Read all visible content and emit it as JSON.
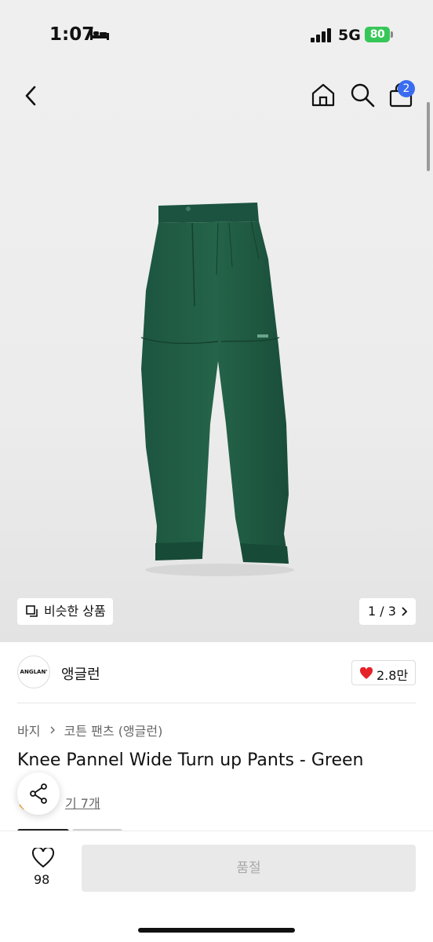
{
  "status": {
    "time": "1:07",
    "network": "5G",
    "battery": "80"
  },
  "nav": {
    "cart_count": "2"
  },
  "gallery": {
    "similar_label": "비슷한 상품",
    "pager": "1 / 3"
  },
  "brand": {
    "logo_text": "ANGLAN'",
    "name": "앵글런",
    "likes": "2.8만"
  },
  "product": {
    "breadcrumb": [
      "바지",
      "코튼 팬츠 (앵글런)"
    ],
    "title": "Knee Pannel Wide Turn up Pants - Green",
    "review_text": "기 7개"
  },
  "bottom": {
    "wish_count": "98",
    "cta_label": "품절"
  },
  "colors": {
    "accent": "#3a6cf0",
    "heart": "#e5222a",
    "battery": "#37c759",
    "product_green": "#1f5a43"
  }
}
